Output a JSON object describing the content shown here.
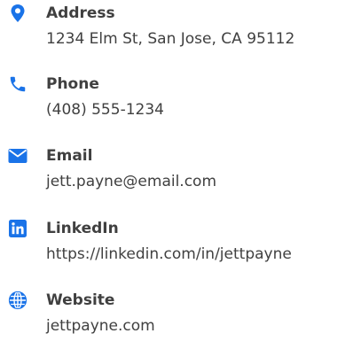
{
  "theme": {
    "icon_color": "#1a73e8",
    "text_color": "#404040"
  },
  "contact": {
    "items": [
      {
        "icon": "map-marker-icon",
        "label": "Address",
        "value": "1234 Elm St, San Jose, CA 95112"
      },
      {
        "icon": "phone-icon",
        "label": "Phone",
        "value": "(408) 555-1234"
      },
      {
        "icon": "envelope-icon",
        "label": "Email",
        "value": "jett.payne@email.com"
      },
      {
        "icon": "linkedin-icon",
        "label": "LinkedIn",
        "value": "https://linkedin.com/in/jettpayne"
      },
      {
        "icon": "globe-icon",
        "label": "Website",
        "value": "jettpayne.com"
      }
    ]
  }
}
